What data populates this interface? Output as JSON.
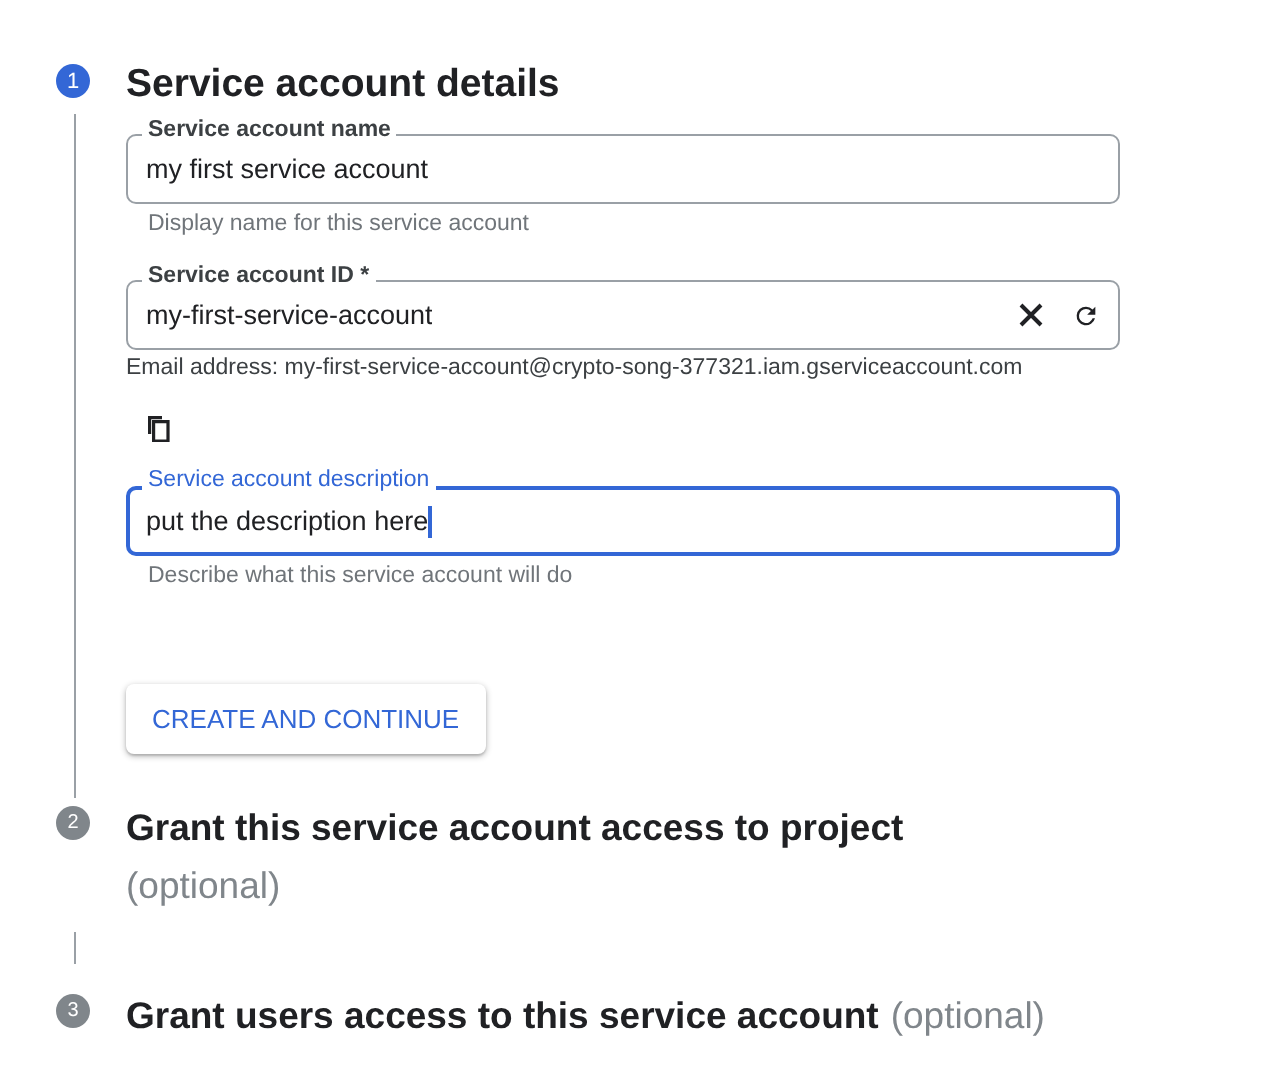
{
  "steps": [
    {
      "number": "1",
      "title": "Service account details",
      "active": true,
      "fields": [
        {
          "kind": "text",
          "label": "Service account name",
          "value": "my first service account",
          "hint": "Display name for this service account",
          "focused": false
        },
        {
          "kind": "id",
          "label": "Service account ID *",
          "value": "my-first-service-account",
          "note": "Email address: my-first-service-account@crypto-song-377321.iam.gserviceaccount.com",
          "focused": false
        },
        {
          "kind": "text",
          "label": "Service account description",
          "value": "put the description here",
          "hint": "Describe what this service account will do",
          "focused": true
        }
      ],
      "button": "CREATE AND CONTINUE"
    },
    {
      "number": "2",
      "title": "Grant this service account access to project",
      "optional": "(optional)",
      "active": false
    },
    {
      "number": "3",
      "title": "Grant users access to this service account",
      "optional": "(optional)",
      "active": false
    }
  ]
}
